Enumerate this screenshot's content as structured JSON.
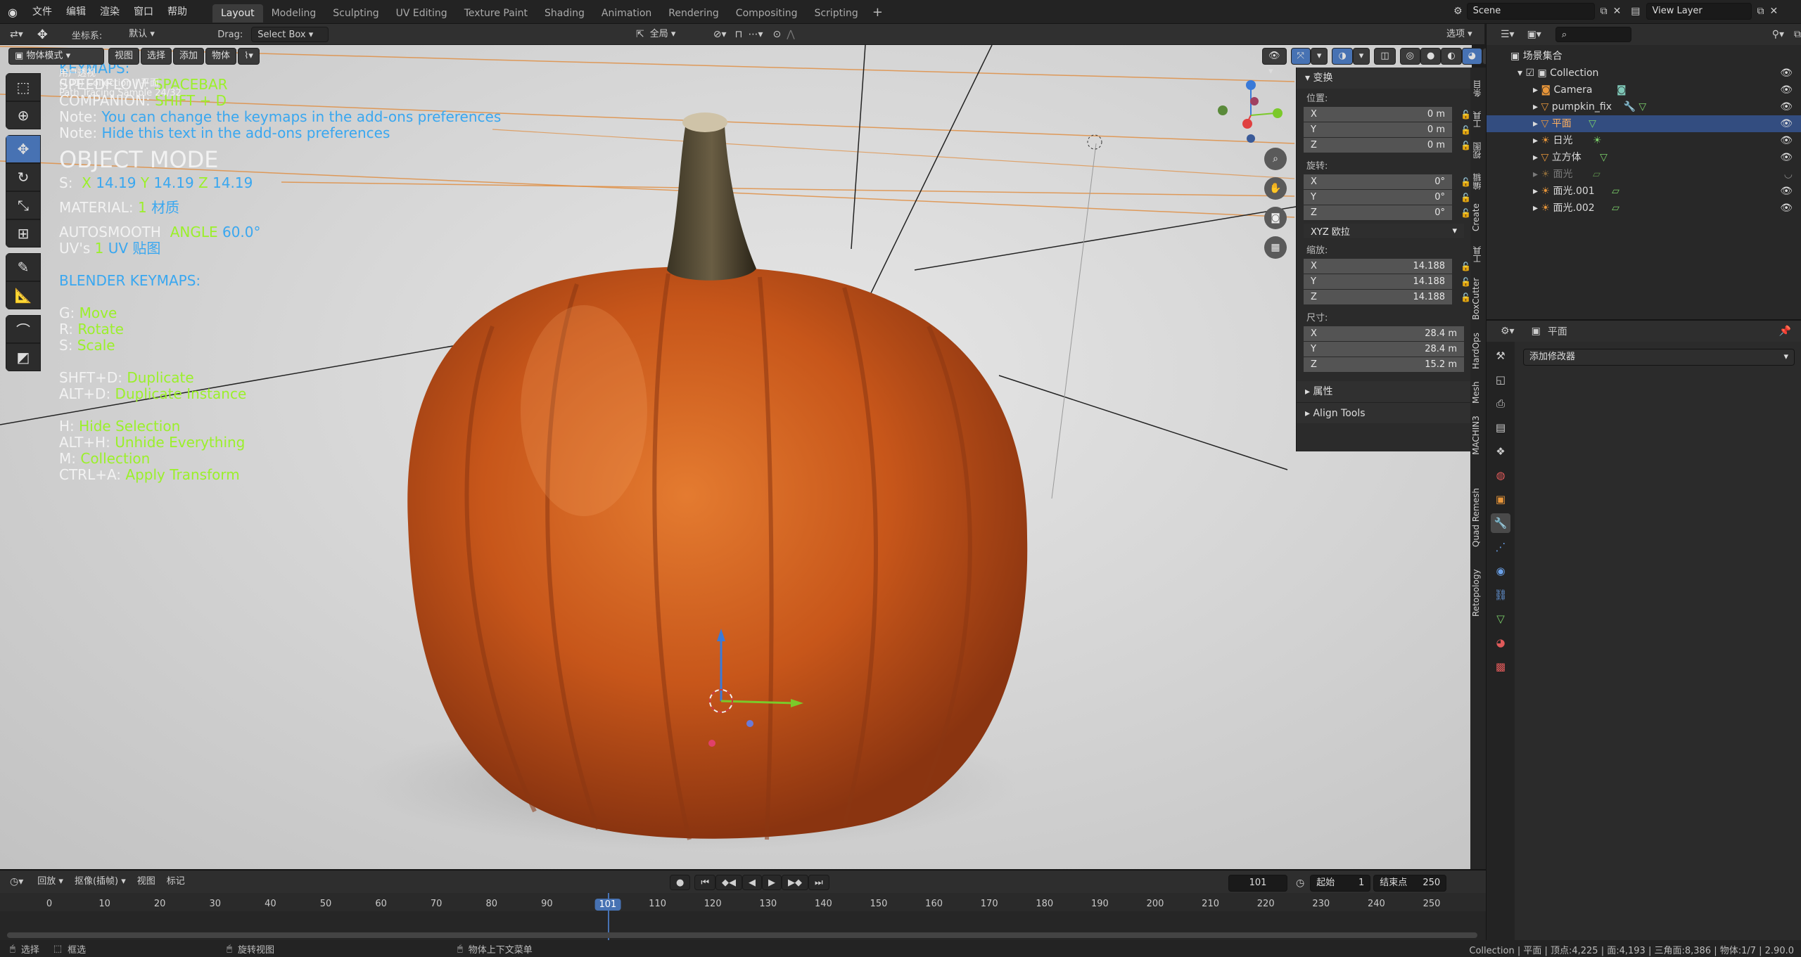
{
  "topbar": {
    "menus": [
      "文件",
      "编辑",
      "渲染",
      "窗口",
      "帮助"
    ],
    "workspaces": [
      "Layout",
      "Modeling",
      "Sculpting",
      "UV Editing",
      "Texture Paint",
      "Shading",
      "Animation",
      "Rendering",
      "Compositing",
      "Scripting"
    ],
    "active_workspace": "Layout",
    "scene": "Scene",
    "view_layer": "View Layer"
  },
  "header": {
    "coord_label": "坐标系:",
    "coord_value": "默认",
    "drag_label": "Drag:",
    "drag_value": "Select Box",
    "pivot_value": "全局",
    "options_label": "选项"
  },
  "viewport_header": {
    "mode": "物体模式",
    "menus": [
      "视图",
      "选择",
      "添加",
      "物体"
    ]
  },
  "overlay": {
    "small1": "用户透视",
    "small2": "(101) Collection | 平面",
    "small3": "Path Tracing Sample 24/32",
    "keymaps_title": "KEYMAPS:",
    "speedflow_label": "SPEEDFLOW:",
    "speedflow_value": "SPACEBAR",
    "companion_label": "COMPANION:",
    "companion_value": "SHIFT + D",
    "note_label": "Note:",
    "note1": "You can change the keymaps in the add-ons preferences",
    "note2": "Hide this text in the add-ons preferences",
    "mode_title": "OBJECT MODE",
    "scale_label": "S:",
    "scale_x_key": "X",
    "scale_x": "14.19",
    "scale_y_key": "Y",
    "scale_y": "14.19",
    "scale_z_key": "Z",
    "scale_z": "14.19",
    "material_label": "MATERIAL:",
    "material_count": "1",
    "material_name": "材质",
    "autosmooth_label": "AUTOSMOOTH",
    "angle_label": "ANGLE",
    "angle_value": "60.0°",
    "uv_label": "UV's",
    "uv_count": "1",
    "uv_name": "UV 贴图",
    "blender_keymaps": "BLENDER KEYMAPS:",
    "keys": [
      {
        "k": "G:",
        "v": "Move"
      },
      {
        "k": "R:",
        "v": "Rotate"
      },
      {
        "k": "S:",
        "v": "Scale"
      },
      {
        "k": "",
        "v": ""
      },
      {
        "k": "SHFT+D:",
        "v": "Duplicate"
      },
      {
        "k": "ALT+D:",
        "v": "Duplicate Instance"
      },
      {
        "k": "",
        "v": ""
      },
      {
        "k": "H:",
        "v": "Hide Selection"
      },
      {
        "k": "ALT+H:",
        "v": "Unhide Everything"
      },
      {
        "k": "M:",
        "v": "Collection"
      },
      {
        "k": "CTRL+A:",
        "v": "Apply Transform"
      }
    ]
  },
  "npanel": {
    "transform_title": "变换",
    "location_label": "位置:",
    "location": [
      {
        "k": "X",
        "v": "0 m"
      },
      {
        "k": "Y",
        "v": "0 m"
      },
      {
        "k": "Z",
        "v": "0 m"
      }
    ],
    "rotation_label": "旋转:",
    "rotation": [
      {
        "k": "X",
        "v": "0°"
      },
      {
        "k": "Y",
        "v": "0°"
      },
      {
        "k": "Z",
        "v": "0°"
      }
    ],
    "rotation_mode": "XYZ 欧拉",
    "scale_label": "缩放:",
    "scale": [
      {
        "k": "X",
        "v": "14.188"
      },
      {
        "k": "Y",
        "v": "14.188"
      },
      {
        "k": "Z",
        "v": "14.188"
      }
    ],
    "dimensions_label": "尺寸:",
    "dimensions": [
      {
        "k": "X",
        "v": "28.4 m"
      },
      {
        "k": "Y",
        "v": "28.4 m"
      },
      {
        "k": "Z",
        "v": "15.2 m"
      }
    ],
    "properties_title": "属性",
    "align_tools_title": "Align Tools"
  },
  "side_tabs": [
    "条目",
    "工具",
    "视图",
    "编辑",
    "Create",
    "工具",
    "BoxCutter",
    "HardOps",
    "Mesh",
    "MACHIN3",
    "Quad Remesh",
    "Retopology"
  ],
  "outliner": {
    "scene_collection": "场景集合",
    "collection": "Collection",
    "items": [
      {
        "name": "Camera",
        "selected": false,
        "dim": false
      },
      {
        "name": "pumpkin_fix",
        "selected": false,
        "dim": false
      },
      {
        "name": "平面",
        "selected": true,
        "dim": false
      },
      {
        "name": "日光",
        "selected": false,
        "dim": false
      },
      {
        "name": "立方体",
        "selected": false,
        "dim": false
      },
      {
        "name": "面光",
        "selected": false,
        "dim": true
      },
      {
        "name": "面光.001",
        "selected": false,
        "dim": false
      },
      {
        "name": "面光.002",
        "selected": false,
        "dim": false
      }
    ]
  },
  "properties": {
    "object_name": "平面",
    "add_modifier": "添加修改器"
  },
  "timeline": {
    "menus": [
      "回放",
      "抠像(插帧)",
      "视图",
      "标记"
    ],
    "current_frame": "101",
    "start_label": "起始",
    "start": "1",
    "end_label": "结束点",
    "end": "250",
    "ticks": [
      "0",
      "10",
      "20",
      "30",
      "40",
      "50",
      "60",
      "70",
      "80",
      "90",
      "101",
      "110",
      "120",
      "130",
      "140",
      "150",
      "160",
      "170",
      "180",
      "190",
      "200",
      "210",
      "220",
      "230",
      "240",
      "250"
    ]
  },
  "statusbar": {
    "select": "选择",
    "box_select": "框选",
    "rotate_view": "旋转视图",
    "context_menu": "物体上下文菜单",
    "stats": "Collection | 平面 | 顶点:4,225 | 面:4,193 | 三角面:8,386 | 物体:1/7 | 2.90.0"
  },
  "colors": {
    "accent": "#4772b3",
    "selected_row": "#334d80",
    "overlay_blue": "#39a7f0",
    "overlay_green": "#9bf02a",
    "pumpkin": "#d9641c"
  }
}
